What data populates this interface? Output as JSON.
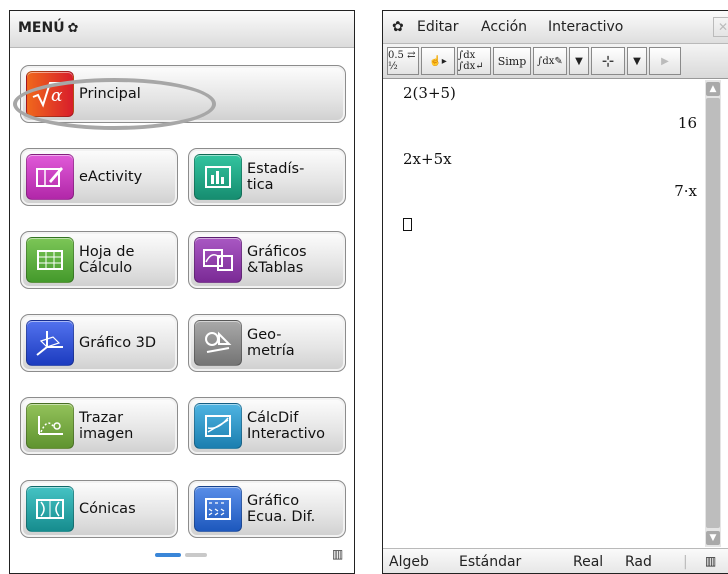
{
  "menu": {
    "title": "MENÚ",
    "tiles": [
      {
        "label": "Principal",
        "icon": "sqrt-alpha-icon",
        "color": "#e23c26"
      },
      {
        "label": "eActivity",
        "icon": "eactivity-icon",
        "color": "#c13ab8"
      },
      {
        "label": "Estadís-\ntica",
        "icon": "statistics-icon",
        "color": "#21a98a"
      },
      {
        "label": "Hoja de\nCálculo",
        "icon": "spreadsheet-icon",
        "color": "#5aa83a"
      },
      {
        "label": "Gráficos\n&Tablas",
        "icon": "graphs-tables-icon",
        "color": "#8c3aa7"
      },
      {
        "label": "Gráfico 3D",
        "icon": "graph-3d-icon",
        "color": "#2f4fd6"
      },
      {
        "label": "Geo-\nmetría",
        "icon": "geometry-icon",
        "color": "#8b8b8b"
      },
      {
        "label": "Trazar\nimagen",
        "icon": "picture-plot-icon",
        "color": "#7aa63a"
      },
      {
        "label": "CálcDif\nInteractivo",
        "icon": "differential-icon",
        "color": "#2f98c8"
      },
      {
        "label": "Cónicas",
        "icon": "conics-icon",
        "color": "#2aa5a8"
      },
      {
        "label": "Gráfico\nEcua. Dif.",
        "icon": "diff-equation-graph-icon",
        "color": "#2f6fd0"
      }
    ]
  },
  "main": {
    "menu_items": [
      "Editar",
      "Acción",
      "Interactivo"
    ],
    "toolbar_buttons": [
      "0.5 ⇄ ½",
      "☝▸",
      "∫dx ∫dx↵",
      "Simp",
      "∫dx✎",
      "▼",
      "⊹",
      "▼",
      "▶"
    ],
    "lines": [
      {
        "input": "2(3+5)",
        "output": "16"
      },
      {
        "input": "2x+5x",
        "output": "7·x"
      }
    ],
    "status": {
      "mode": "Algeb",
      "format": "Estándar",
      "number": "Real",
      "angle": "Rad"
    }
  }
}
